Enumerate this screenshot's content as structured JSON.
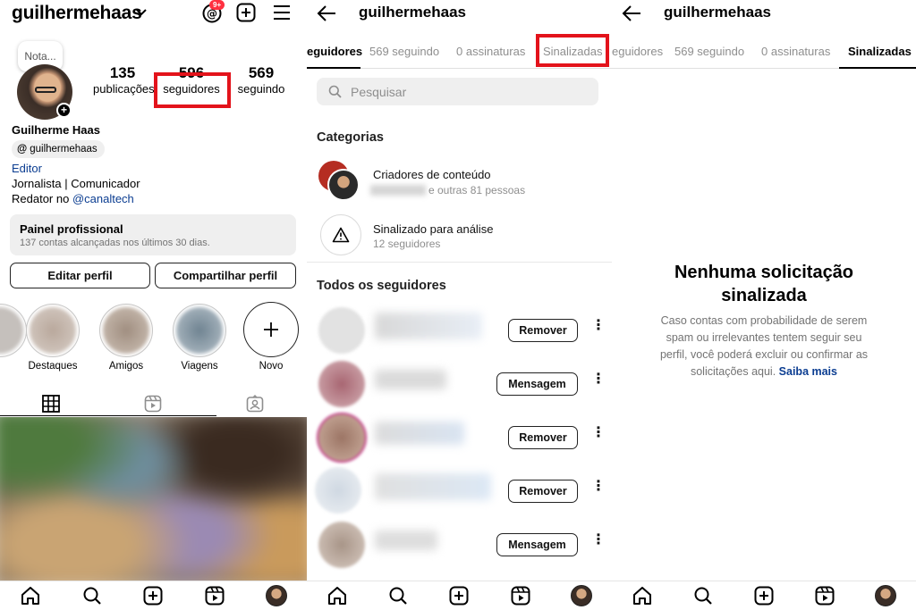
{
  "profile_screen": {
    "username": "guilhermehaas",
    "threads_badge": "9+",
    "note_label": "Nota...",
    "stats": [
      {
        "value": "135",
        "label": "publicações"
      },
      {
        "value": "596",
        "label": "seguidores"
      },
      {
        "value": "569",
        "label": "seguindo"
      }
    ],
    "display_name": "Guilherme Haas",
    "threads_handle": "guilhermehaas",
    "category": "Editor",
    "bio_line1": "Jornalista | Comunicador",
    "bio_prefix": "Redator no ",
    "bio_mention": "@canaltech",
    "pro_panel_title": "Painel profissional",
    "pro_panel_sub": "137 contas alcançadas nos últimos 30 dias.",
    "edit_button": "Editar perfil",
    "share_button": "Compartilhar perfil",
    "highlights": [
      {
        "label": "Destaques",
        "color": "#b9a89c"
      },
      {
        "label": "Amigos",
        "color": "#a08e80"
      },
      {
        "label": "Viagens",
        "color": "#7d8e9a"
      },
      {
        "label": "Novo",
        "color": "#ffffff"
      }
    ]
  },
  "followers_screen": {
    "username": "guilhermehaas",
    "tabs": [
      "eguidores",
      "569 seguindo",
      "0 assinaturas",
      "Sinalizadas"
    ],
    "search_placeholder": "Pesquisar",
    "categories_heading": "Categorias",
    "categories": [
      {
        "title": "Criadores de conteúdo",
        "sub": "e outras 81 pessoas"
      },
      {
        "title": "Sinalizado para análise",
        "sub": "12 seguidores"
      }
    ],
    "all_followers_heading": "Todos os seguidores",
    "followers": [
      {
        "button": "Remover",
        "color": "#dcdcdc"
      },
      {
        "button": "Mensagem",
        "color": "#b07880"
      },
      {
        "button": "Remover",
        "color": "#a88070"
      },
      {
        "button": "Remover",
        "color": "#d8dde3"
      },
      {
        "button": "Mensagem",
        "color": "#b4a59a"
      }
    ]
  },
  "flagged_screen": {
    "username": "guilhermehaas",
    "tabs": [
      "eguidores",
      "569 seguindo",
      "0 assinaturas",
      "Sinalizadas"
    ],
    "empty_title": "Nenhuma solicitação sinalizada",
    "empty_desc": "Caso contas com probabilidade de serem spam ou irrelevantes tentem seguir seu perfil, você poderá excluir ou confirmar as solicitações aqui.",
    "learn_more": "Saiba mais"
  },
  "colors": {
    "highlight_box": "#e3131b",
    "link": "#0b3d91",
    "badge": "#ff3040",
    "secondary_text": "#8e8e8e"
  }
}
